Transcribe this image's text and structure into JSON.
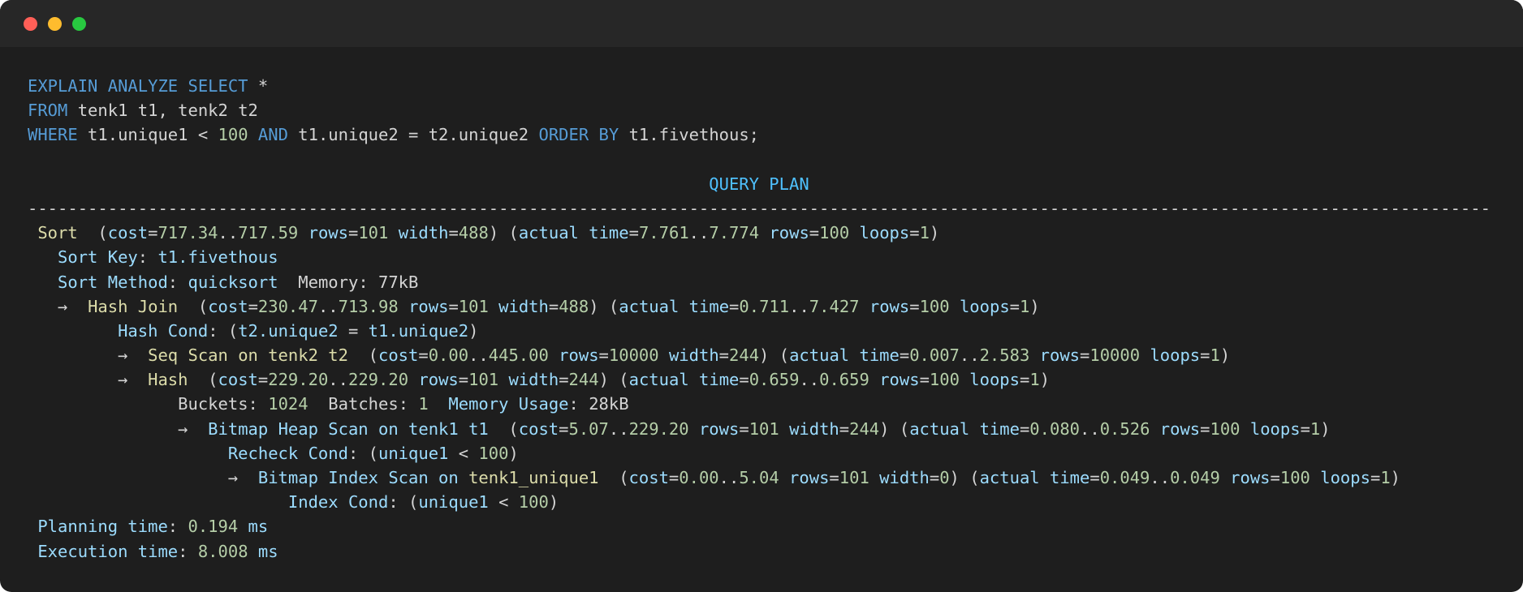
{
  "window": {
    "controls": [
      "close",
      "minimize",
      "maximize"
    ]
  },
  "query": {
    "line1": [
      {
        "t": "EXPLAIN ANALYZE SELECT",
        "c": "kw"
      },
      {
        "t": " *",
        "c": "txt"
      }
    ],
    "line2": [
      {
        "t": "FROM",
        "c": "kw"
      },
      {
        "t": " tenk1 t1, tenk2 t2",
        "c": "txt"
      }
    ],
    "line3": [
      {
        "t": "WHERE",
        "c": "kw"
      },
      {
        "t": " t1.unique1 < ",
        "c": "txt"
      },
      {
        "t": "100",
        "c": "num"
      },
      {
        "t": " ",
        "c": "txt"
      },
      {
        "t": "AND",
        "c": "kw"
      },
      {
        "t": " t1.unique2 = t2.unique2 ",
        "c": "txt"
      },
      {
        "t": "ORDER BY",
        "c": "kw"
      },
      {
        "t": " t1.fivethous;",
        "c": "txt"
      }
    ]
  },
  "plan": {
    "header": "QUERY PLAN",
    "separator": "--------------------------------------------------------------------------------------------------------------------------------------------------",
    "rows": [
      [
        {
          "t": " ",
          "c": "txt"
        },
        {
          "t": "Sort",
          "c": "node"
        },
        {
          "t": "  (",
          "c": "txt"
        },
        {
          "t": "cost",
          "c": "id"
        },
        {
          "t": "=",
          "c": "txt"
        },
        {
          "t": "717.34",
          "c": "num"
        },
        {
          "t": "..",
          "c": "txt"
        },
        {
          "t": "717.59",
          "c": "num"
        },
        {
          "t": " ",
          "c": "txt"
        },
        {
          "t": "rows",
          "c": "id"
        },
        {
          "t": "=",
          "c": "txt"
        },
        {
          "t": "101",
          "c": "num"
        },
        {
          "t": " ",
          "c": "txt"
        },
        {
          "t": "width",
          "c": "id"
        },
        {
          "t": "=",
          "c": "txt"
        },
        {
          "t": "488",
          "c": "num"
        },
        {
          "t": ") (",
          "c": "txt"
        },
        {
          "t": "actual time",
          "c": "id"
        },
        {
          "t": "=",
          "c": "txt"
        },
        {
          "t": "7.761",
          "c": "num"
        },
        {
          "t": "..",
          "c": "txt"
        },
        {
          "t": "7.774",
          "c": "num"
        },
        {
          "t": " ",
          "c": "txt"
        },
        {
          "t": "rows",
          "c": "id"
        },
        {
          "t": "=",
          "c": "txt"
        },
        {
          "t": "100",
          "c": "num"
        },
        {
          "t": " ",
          "c": "txt"
        },
        {
          "t": "loops",
          "c": "id"
        },
        {
          "t": "=",
          "c": "txt"
        },
        {
          "t": "1",
          "c": "num"
        },
        {
          "t": ")",
          "c": "txt"
        }
      ],
      [
        {
          "t": "   ",
          "c": "txt"
        },
        {
          "t": "Sort Key",
          "c": "id"
        },
        {
          "t": ": ",
          "c": "txt"
        },
        {
          "t": "t1.fivethous",
          "c": "id"
        }
      ],
      [
        {
          "t": "   ",
          "c": "txt"
        },
        {
          "t": "Sort Method",
          "c": "id"
        },
        {
          "t": ": ",
          "c": "txt"
        },
        {
          "t": "quicksort",
          "c": "id"
        },
        {
          "t": "  Memory: ",
          "c": "txt"
        },
        {
          "t": "77kB",
          "c": "txt"
        }
      ],
      [
        {
          "t": "   →  ",
          "c": "txt"
        },
        {
          "t": "Hash Join",
          "c": "node"
        },
        {
          "t": "  (",
          "c": "txt"
        },
        {
          "t": "cost",
          "c": "id"
        },
        {
          "t": "=",
          "c": "txt"
        },
        {
          "t": "230.47",
          "c": "num"
        },
        {
          "t": "..",
          "c": "txt"
        },
        {
          "t": "713.98",
          "c": "num"
        },
        {
          "t": " ",
          "c": "txt"
        },
        {
          "t": "rows",
          "c": "id"
        },
        {
          "t": "=",
          "c": "txt"
        },
        {
          "t": "101",
          "c": "num"
        },
        {
          "t": " ",
          "c": "txt"
        },
        {
          "t": "width",
          "c": "id"
        },
        {
          "t": "=",
          "c": "txt"
        },
        {
          "t": "488",
          "c": "num"
        },
        {
          "t": ") (",
          "c": "txt"
        },
        {
          "t": "actual time",
          "c": "id"
        },
        {
          "t": "=",
          "c": "txt"
        },
        {
          "t": "0.711",
          "c": "num"
        },
        {
          "t": "..",
          "c": "txt"
        },
        {
          "t": "7.427",
          "c": "num"
        },
        {
          "t": " ",
          "c": "txt"
        },
        {
          "t": "rows",
          "c": "id"
        },
        {
          "t": "=",
          "c": "txt"
        },
        {
          "t": "100",
          "c": "num"
        },
        {
          "t": " ",
          "c": "txt"
        },
        {
          "t": "loops",
          "c": "id"
        },
        {
          "t": "=",
          "c": "txt"
        },
        {
          "t": "1",
          "c": "num"
        },
        {
          "t": ")",
          "c": "txt"
        }
      ],
      [
        {
          "t": "         ",
          "c": "txt"
        },
        {
          "t": "Hash Cond",
          "c": "id"
        },
        {
          "t": ": (",
          "c": "txt"
        },
        {
          "t": "t2.unique2",
          "c": "id"
        },
        {
          "t": " = ",
          "c": "txt"
        },
        {
          "t": "t1.unique2",
          "c": "id"
        },
        {
          "t": ")",
          "c": "txt"
        }
      ],
      [
        {
          "t": "         →  ",
          "c": "txt"
        },
        {
          "t": "Seq Scan on tenk2 t2",
          "c": "node"
        },
        {
          "t": "  (",
          "c": "txt"
        },
        {
          "t": "cost",
          "c": "id"
        },
        {
          "t": "=",
          "c": "txt"
        },
        {
          "t": "0.00",
          "c": "num"
        },
        {
          "t": "..",
          "c": "txt"
        },
        {
          "t": "445.00",
          "c": "num"
        },
        {
          "t": " ",
          "c": "txt"
        },
        {
          "t": "rows",
          "c": "id"
        },
        {
          "t": "=",
          "c": "txt"
        },
        {
          "t": "10000",
          "c": "num"
        },
        {
          "t": " ",
          "c": "txt"
        },
        {
          "t": "width",
          "c": "id"
        },
        {
          "t": "=",
          "c": "txt"
        },
        {
          "t": "244",
          "c": "num"
        },
        {
          "t": ") (",
          "c": "txt"
        },
        {
          "t": "actual time",
          "c": "id"
        },
        {
          "t": "=",
          "c": "txt"
        },
        {
          "t": "0.007",
          "c": "num"
        },
        {
          "t": "..",
          "c": "txt"
        },
        {
          "t": "2.583",
          "c": "num"
        },
        {
          "t": " ",
          "c": "txt"
        },
        {
          "t": "rows",
          "c": "id"
        },
        {
          "t": "=",
          "c": "txt"
        },
        {
          "t": "10000",
          "c": "num"
        },
        {
          "t": " ",
          "c": "txt"
        },
        {
          "t": "loops",
          "c": "id"
        },
        {
          "t": "=",
          "c": "txt"
        },
        {
          "t": "1",
          "c": "num"
        },
        {
          "t": ")",
          "c": "txt"
        }
      ],
      [
        {
          "t": "         →  ",
          "c": "txt"
        },
        {
          "t": "Hash",
          "c": "node"
        },
        {
          "t": "  (",
          "c": "txt"
        },
        {
          "t": "cost",
          "c": "id"
        },
        {
          "t": "=",
          "c": "txt"
        },
        {
          "t": "229.20",
          "c": "num"
        },
        {
          "t": "..",
          "c": "txt"
        },
        {
          "t": "229.20",
          "c": "num"
        },
        {
          "t": " ",
          "c": "txt"
        },
        {
          "t": "rows",
          "c": "id"
        },
        {
          "t": "=",
          "c": "txt"
        },
        {
          "t": "101",
          "c": "num"
        },
        {
          "t": " ",
          "c": "txt"
        },
        {
          "t": "width",
          "c": "id"
        },
        {
          "t": "=",
          "c": "txt"
        },
        {
          "t": "244",
          "c": "num"
        },
        {
          "t": ") (",
          "c": "txt"
        },
        {
          "t": "actual time",
          "c": "id"
        },
        {
          "t": "=",
          "c": "txt"
        },
        {
          "t": "0.659",
          "c": "num"
        },
        {
          "t": "..",
          "c": "txt"
        },
        {
          "t": "0.659",
          "c": "num"
        },
        {
          "t": " ",
          "c": "txt"
        },
        {
          "t": "rows",
          "c": "id"
        },
        {
          "t": "=",
          "c": "txt"
        },
        {
          "t": "100",
          "c": "num"
        },
        {
          "t": " ",
          "c": "txt"
        },
        {
          "t": "loops",
          "c": "id"
        },
        {
          "t": "=",
          "c": "txt"
        },
        {
          "t": "1",
          "c": "num"
        },
        {
          "t": ")",
          "c": "txt"
        }
      ],
      [
        {
          "t": "               ",
          "c": "txt"
        },
        {
          "t": "Buckets: ",
          "c": "txt"
        },
        {
          "t": "1024",
          "c": "num"
        },
        {
          "t": "  Batches: ",
          "c": "txt"
        },
        {
          "t": "1",
          "c": "num"
        },
        {
          "t": "  ",
          "c": "txt"
        },
        {
          "t": "Memory Usage",
          "c": "id"
        },
        {
          "t": ": ",
          "c": "txt"
        },
        {
          "t": "28kB",
          "c": "txt"
        }
      ],
      [
        {
          "t": "               →  ",
          "c": "txt"
        },
        {
          "t": "Bitmap Heap Scan on tenk1 t1",
          "c": "id"
        },
        {
          "t": "  (",
          "c": "txt"
        },
        {
          "t": "cost",
          "c": "id"
        },
        {
          "t": "=",
          "c": "txt"
        },
        {
          "t": "5.07",
          "c": "num"
        },
        {
          "t": "..",
          "c": "txt"
        },
        {
          "t": "229.20",
          "c": "num"
        },
        {
          "t": " ",
          "c": "txt"
        },
        {
          "t": "rows",
          "c": "id"
        },
        {
          "t": "=",
          "c": "txt"
        },
        {
          "t": "101",
          "c": "num"
        },
        {
          "t": " ",
          "c": "txt"
        },
        {
          "t": "width",
          "c": "id"
        },
        {
          "t": "=",
          "c": "txt"
        },
        {
          "t": "244",
          "c": "num"
        },
        {
          "t": ") (",
          "c": "txt"
        },
        {
          "t": "actual time",
          "c": "id"
        },
        {
          "t": "=",
          "c": "txt"
        },
        {
          "t": "0.080",
          "c": "num"
        },
        {
          "t": "..",
          "c": "txt"
        },
        {
          "t": "0.526",
          "c": "num"
        },
        {
          "t": " ",
          "c": "txt"
        },
        {
          "t": "rows",
          "c": "id"
        },
        {
          "t": "=",
          "c": "txt"
        },
        {
          "t": "100",
          "c": "num"
        },
        {
          "t": " ",
          "c": "txt"
        },
        {
          "t": "loops",
          "c": "id"
        },
        {
          "t": "=",
          "c": "txt"
        },
        {
          "t": "1",
          "c": "num"
        },
        {
          "t": ")",
          "c": "txt"
        }
      ],
      [
        {
          "t": "                    ",
          "c": "txt"
        },
        {
          "t": "Recheck Cond",
          "c": "id"
        },
        {
          "t": ": (",
          "c": "txt"
        },
        {
          "t": "unique1",
          "c": "id"
        },
        {
          "t": " < ",
          "c": "txt"
        },
        {
          "t": "100",
          "c": "num"
        },
        {
          "t": ")",
          "c": "txt"
        }
      ],
      [
        {
          "t": "                    →  ",
          "c": "txt"
        },
        {
          "t": "Bitmap Index Scan on ",
          "c": "id"
        },
        {
          "t": "tenk1_unique1",
          "c": "node"
        },
        {
          "t": "  (",
          "c": "txt"
        },
        {
          "t": "cost",
          "c": "id"
        },
        {
          "t": "=",
          "c": "txt"
        },
        {
          "t": "0.00",
          "c": "num"
        },
        {
          "t": "..",
          "c": "txt"
        },
        {
          "t": "5.04",
          "c": "num"
        },
        {
          "t": " ",
          "c": "txt"
        },
        {
          "t": "rows",
          "c": "id"
        },
        {
          "t": "=",
          "c": "txt"
        },
        {
          "t": "101",
          "c": "num"
        },
        {
          "t": " ",
          "c": "txt"
        },
        {
          "t": "width",
          "c": "id"
        },
        {
          "t": "=",
          "c": "txt"
        },
        {
          "t": "0",
          "c": "num"
        },
        {
          "t": ") (",
          "c": "txt"
        },
        {
          "t": "actual time",
          "c": "id"
        },
        {
          "t": "=",
          "c": "txt"
        },
        {
          "t": "0.049",
          "c": "num"
        },
        {
          "t": "..",
          "c": "txt"
        },
        {
          "t": "0.049",
          "c": "num"
        },
        {
          "t": " ",
          "c": "txt"
        },
        {
          "t": "rows",
          "c": "id"
        },
        {
          "t": "=",
          "c": "txt"
        },
        {
          "t": "100",
          "c": "num"
        },
        {
          "t": " ",
          "c": "txt"
        },
        {
          "t": "loops",
          "c": "id"
        },
        {
          "t": "=",
          "c": "txt"
        },
        {
          "t": "1",
          "c": "num"
        },
        {
          "t": ")",
          "c": "txt"
        }
      ],
      [
        {
          "t": "                          ",
          "c": "txt"
        },
        {
          "t": "Index Cond",
          "c": "id"
        },
        {
          "t": ": (",
          "c": "txt"
        },
        {
          "t": "unique1",
          "c": "id"
        },
        {
          "t": " < ",
          "c": "txt"
        },
        {
          "t": "100",
          "c": "num"
        },
        {
          "t": ")",
          "c": "txt"
        }
      ],
      [
        {
          "t": " ",
          "c": "txt"
        },
        {
          "t": "Planning time",
          "c": "id"
        },
        {
          "t": ": ",
          "c": "txt"
        },
        {
          "t": "0.194",
          "c": "num"
        },
        {
          "t": " ms",
          "c": "id"
        }
      ],
      [
        {
          "t": " ",
          "c": "txt"
        },
        {
          "t": "Execution time",
          "c": "id"
        },
        {
          "t": ": ",
          "c": "txt"
        },
        {
          "t": "8.008",
          "c": "num"
        },
        {
          "t": " ms",
          "c": "id"
        }
      ]
    ]
  }
}
